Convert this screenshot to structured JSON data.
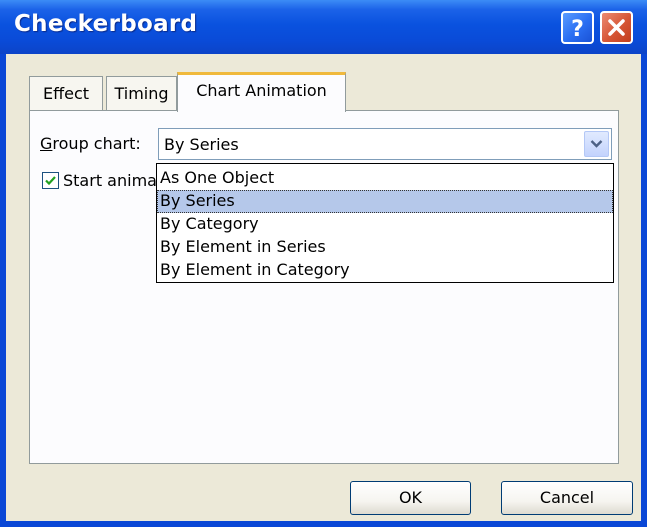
{
  "window": {
    "title": "Checkerboard",
    "help_icon": "help-icon",
    "close_icon": "close-icon"
  },
  "tabs": [
    {
      "label": "Effect"
    },
    {
      "label": "Timing"
    },
    {
      "label": "Chart Animation",
      "active": true
    }
  ],
  "chart_animation": {
    "group_chart_label": "Group chart:",
    "group_chart_value": "By Series",
    "start_animation_label": "Start animating background",
    "start_animation_checked": true
  },
  "dropdown": {
    "options": [
      {
        "label": "As One Object"
      },
      {
        "label": "By Series",
        "selected": true
      },
      {
        "label": "By Category"
      },
      {
        "label": "By Element in Series"
      },
      {
        "label": "By Element in Category"
      }
    ]
  },
  "buttons": {
    "ok": "OK",
    "cancel": "Cancel"
  },
  "colors": {
    "titlebar": "#0a52df",
    "dialog_bg": "#ece9d8",
    "selection": "#b5c8ea",
    "active_tab_accent": "#f0b93c"
  }
}
